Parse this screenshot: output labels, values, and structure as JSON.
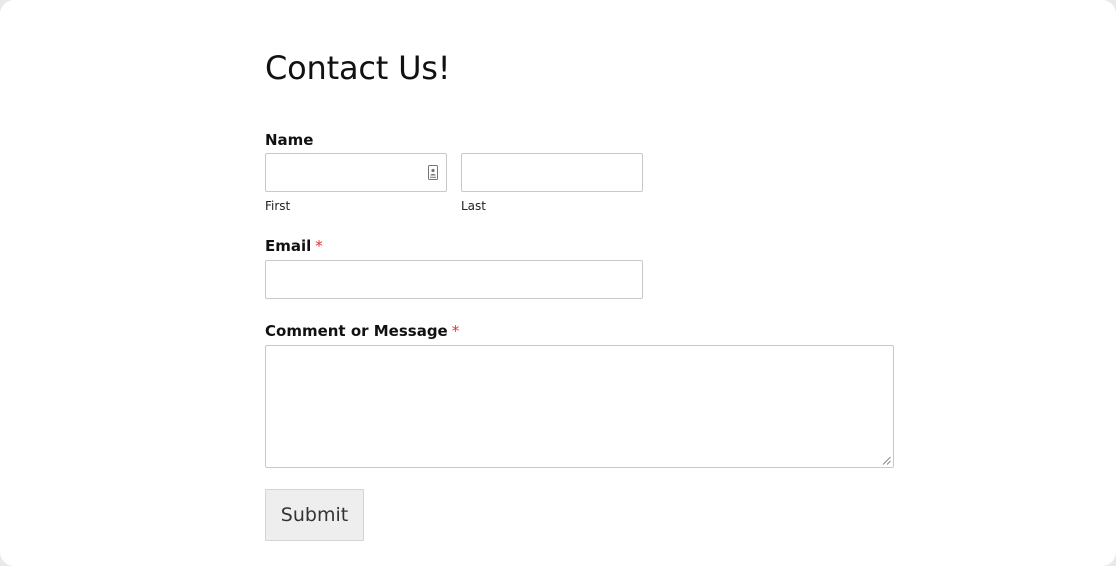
{
  "form": {
    "title": "Contact Us!",
    "name": {
      "label": "Name",
      "first": {
        "sublabel": "First",
        "value": "",
        "icon": "contact-card-icon"
      },
      "last": {
        "sublabel": "Last",
        "value": ""
      }
    },
    "email": {
      "label": "Email",
      "required_marker": "*",
      "value": ""
    },
    "comment": {
      "label": "Comment or Message",
      "required_marker": "*",
      "value": ""
    },
    "submit_label": "Submit"
  },
  "colors": {
    "required": "#d63637",
    "border": "#c9c9c9",
    "button_bg": "#eeeeee"
  }
}
